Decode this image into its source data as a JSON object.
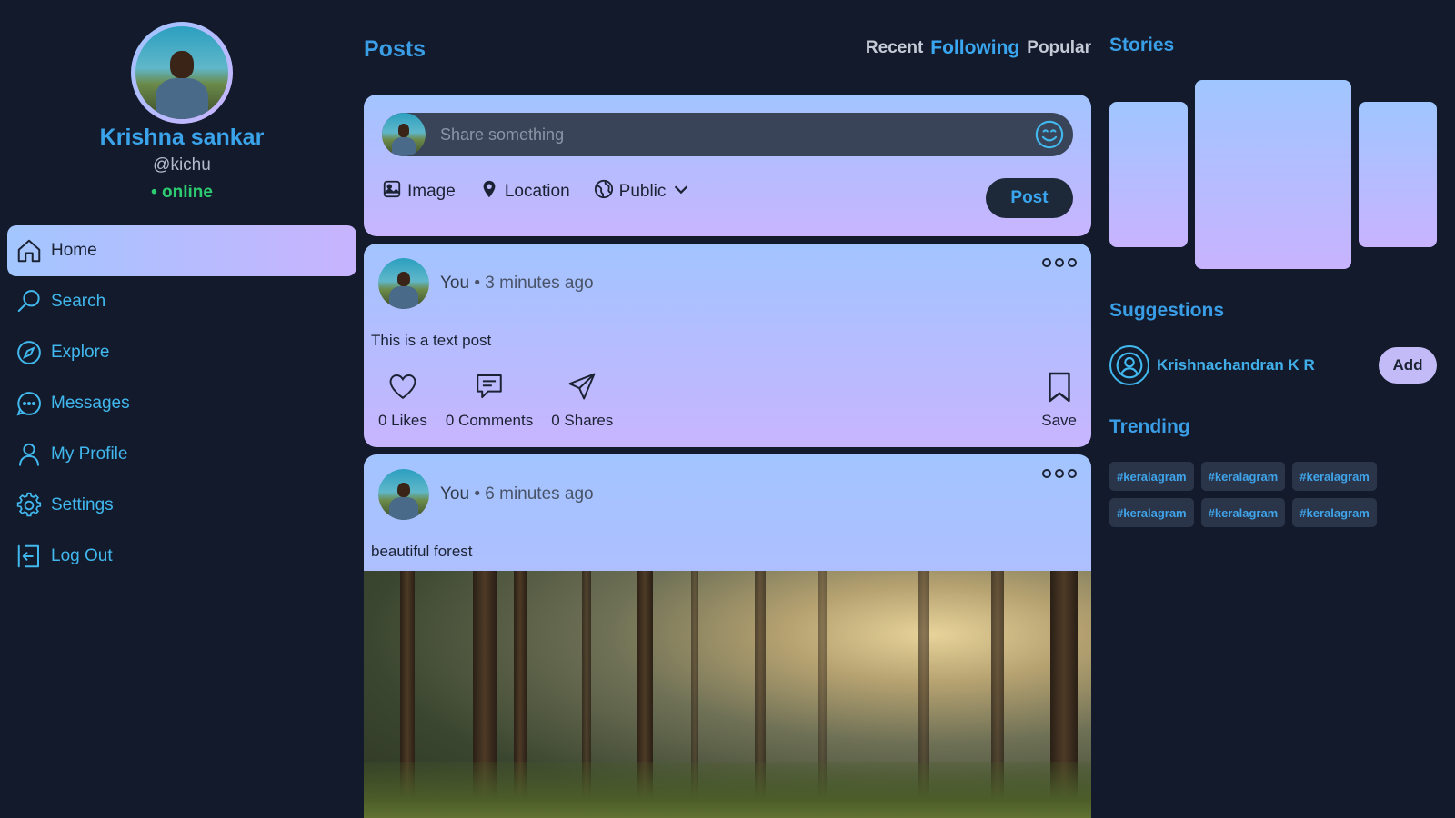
{
  "profile": {
    "name": "Krishna sankar",
    "handle": "@kichu",
    "status": "• online"
  },
  "nav": {
    "items": [
      {
        "label": "Home",
        "icon": "home-icon"
      },
      {
        "label": "Search",
        "icon": "search-icon"
      },
      {
        "label": "Explore",
        "icon": "compass-icon"
      },
      {
        "label": "Messages",
        "icon": "chat-icon"
      },
      {
        "label": "My Profile",
        "icon": "user-icon"
      },
      {
        "label": "Settings",
        "icon": "gear-icon"
      },
      {
        "label": "Log Out",
        "icon": "logout-icon"
      }
    ],
    "active": "Home"
  },
  "feed": {
    "title": "Posts",
    "filters": [
      "Recent",
      "Following",
      "Popular"
    ],
    "active_filter": "Following"
  },
  "composer": {
    "placeholder": "Share something",
    "tools": {
      "image": "Image",
      "location": "Location",
      "visibility": "Public"
    },
    "post_label": "Post"
  },
  "posts": [
    {
      "author": "You",
      "time": "• 3 minutes ago",
      "text": "This is a text post",
      "likes": "0 Likes",
      "comments": "0 Comments",
      "shares": "0 Shares",
      "save": "Save"
    },
    {
      "author": "You",
      "time": "• 6 minutes ago",
      "text": "beautiful forest"
    }
  ],
  "right": {
    "stories_title": "Stories",
    "suggestions_title": "Suggestions",
    "suggestion": {
      "name": "Krishnachandran K R",
      "add_label": "Add"
    },
    "trending_title": "Trending",
    "tags": [
      "#keralagram",
      "#keralagram",
      "#keralagram",
      "#keralagram",
      "#keralagram",
      "#keralagram"
    ]
  },
  "colors": {
    "background": "#121a2c",
    "accent": "#3aa3ea",
    "online": "#2ecc71",
    "card_gradient_start": "#a2c4ff",
    "card_gradient_end": "#c8b5ff"
  }
}
